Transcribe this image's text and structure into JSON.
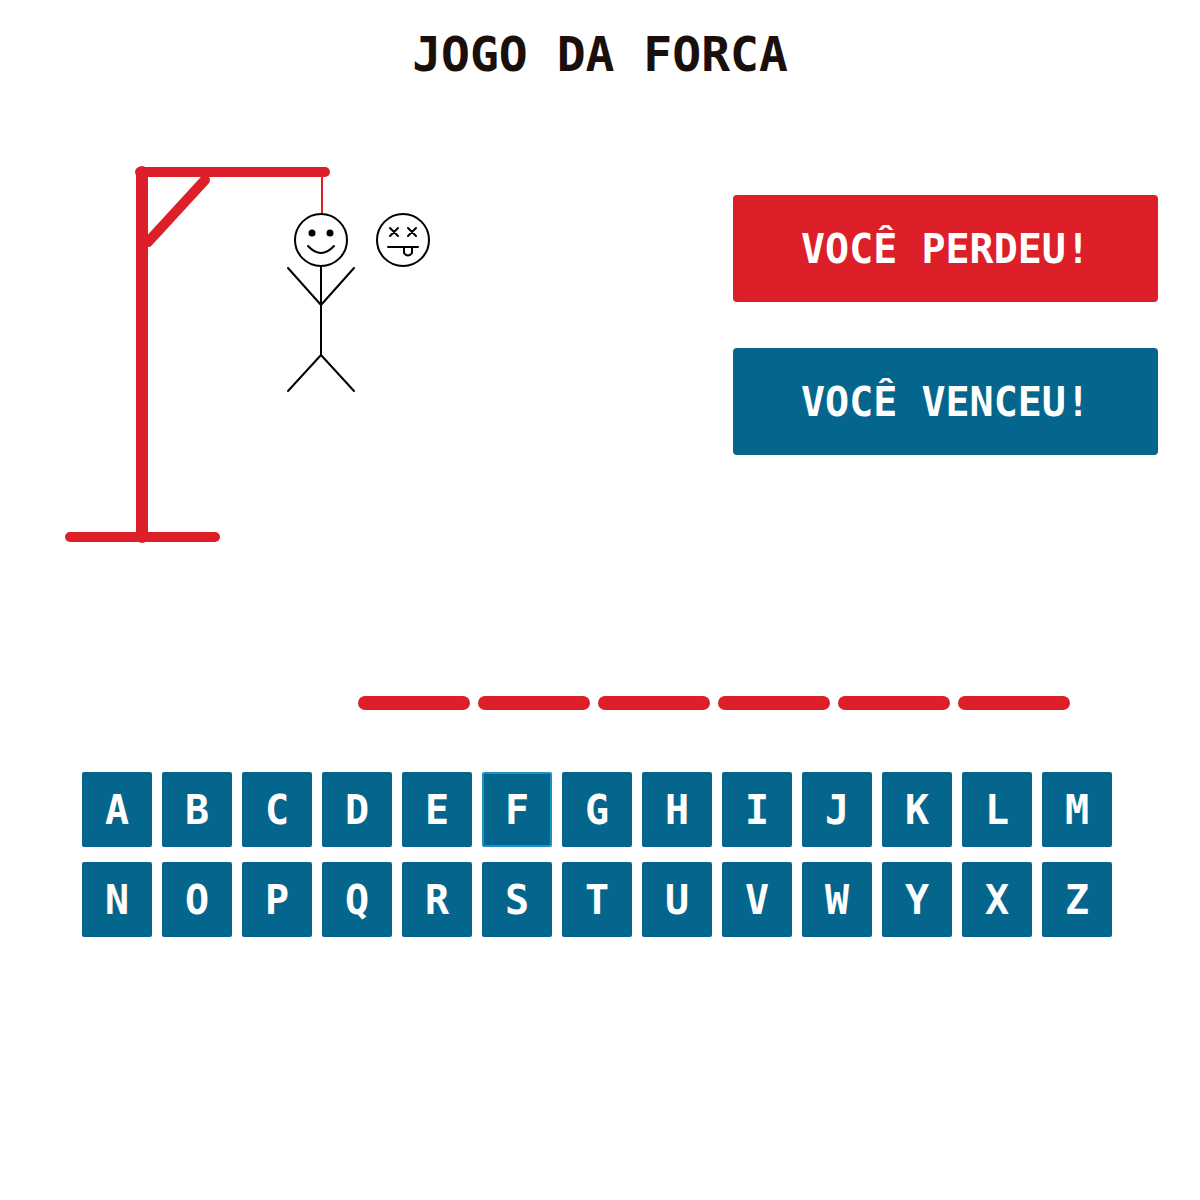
{
  "title": "JOGO DA FORCA",
  "hangman": {
    "parts": 6
  },
  "messages": [
    {
      "text": "VOCÊ PERDEU!",
      "color": "#dc1f28"
    },
    {
      "text": "VOCÊ VENCEU!",
      "color": "#05668d"
    }
  ],
  "slots": [
    {
      "letter": ""
    },
    {
      "letter": ""
    },
    {
      "letter": ""
    },
    {
      "letter": ""
    },
    {
      "letter": ""
    },
    {
      "letter": ""
    }
  ],
  "keyboard": [
    [
      {
        "letter": "A",
        "selected": false
      },
      {
        "letter": "B",
        "selected": false
      },
      {
        "letter": "C",
        "selected": false
      },
      {
        "letter": "D",
        "selected": false
      },
      {
        "letter": "E",
        "selected": false
      },
      {
        "letter": "F",
        "selected": true
      },
      {
        "letter": "G",
        "selected": false
      },
      {
        "letter": "H",
        "selected": false
      },
      {
        "letter": "I",
        "selected": false
      },
      {
        "letter": "J",
        "selected": false
      },
      {
        "letter": "K",
        "selected": false
      },
      {
        "letter": "L",
        "selected": false
      },
      {
        "letter": "M",
        "selected": false
      }
    ],
    [
      {
        "letter": "N",
        "selected": false
      },
      {
        "letter": "O",
        "selected": false
      },
      {
        "letter": "P",
        "selected": false
      },
      {
        "letter": "Q",
        "selected": false
      },
      {
        "letter": "R",
        "selected": false
      },
      {
        "letter": "S",
        "selected": false
      },
      {
        "letter": "T",
        "selected": false
      },
      {
        "letter": "U",
        "selected": false
      },
      {
        "letter": "V",
        "selected": false
      },
      {
        "letter": "W",
        "selected": false
      },
      {
        "letter": "Y",
        "selected": false
      },
      {
        "letter": "X",
        "selected": false
      },
      {
        "letter": "Z",
        "selected": false
      }
    ]
  ]
}
